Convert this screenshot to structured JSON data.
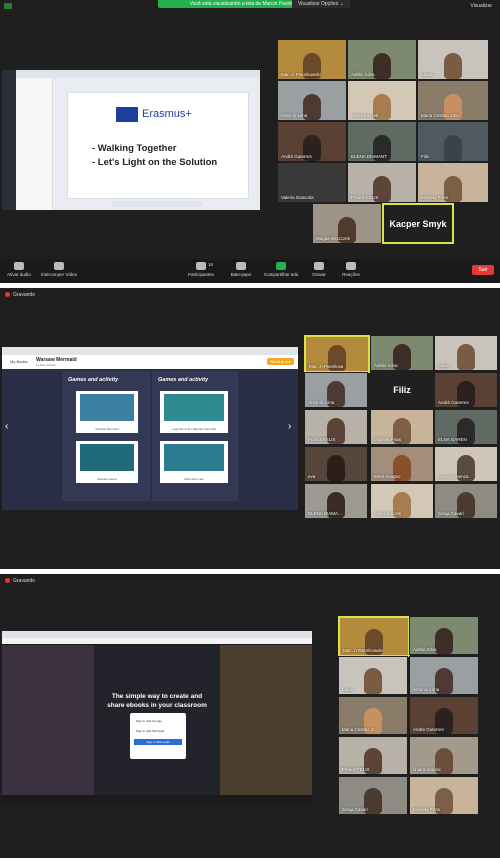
{
  "p1": {
    "banner": "Você está visualizando a tela de Marcin Pasnikowski",
    "view_options": "Visualizar Opções ⌄",
    "top_right": "Visualizar",
    "slide": {
      "brand": "Erasmus+",
      "line1": "- Walking Together",
      "line2": "- Let's Light on the Solution"
    },
    "participants": [
      {
        "name": "Mar...n Pasnikowski"
      },
      {
        "name": "Adélio Silva"
      },
      {
        "name": "Laura"
      },
      {
        "name": "António Lima"
      },
      {
        "name": "emilia baczek"
      },
      {
        "name": "Maria Cristina Zoie"
      },
      {
        "name": "André Guterres"
      },
      {
        "name": "ELENA DIAMANT"
      },
      {
        "name": "Filiz"
      },
      {
        "name": "Valeria Giancola"
      },
      {
        "name": "Franck FELIX"
      },
      {
        "name": "Michela Piras"
      },
      {
        "name": "Magda Wiszczek"
      },
      {
        "name": "Kacper Smyk"
      }
    ],
    "toolbar": {
      "mute": "Ativar áudio",
      "video": "Interromper Vídeo",
      "participants": "Participantes",
      "participants_count": "16",
      "chat": "Bate-papo",
      "share": "Compartilhar tela",
      "record": "Gravar",
      "reactions": "Reações",
      "end": "Sair"
    }
  },
  "p2": {
    "recording": "Gravando",
    "book_title": "Warsaw Mermaid",
    "book_author": "by Ewa Wojcik",
    "my_books": "My Books",
    "read_to_me": "Read to me",
    "page_heading": "Games and activity",
    "cards": [
      {
        "caption": "Warsaw Mermaid"
      },
      {
        "caption": "Legends of the Warsaw Mermaid"
      },
      {
        "caption": "Warsaw waves"
      },
      {
        "caption": "Mermaid's tale"
      }
    ],
    "participants": [
      {
        "name": "Mar...n Pasnikow"
      },
      {
        "name": "Adélio Silva"
      },
      {
        "name": "Laura"
      },
      {
        "name": "António Lima"
      },
      {
        "name": "Filiz"
      },
      {
        "name": "André Guterres"
      },
      {
        "name": "Franck FELIX"
      },
      {
        "name": "Michela Piras"
      },
      {
        "name": "ELNA GAREN"
      },
      {
        "name": "eva"
      },
      {
        "name": "Eleni Anagno"
      },
      {
        "name": "Laura Cusenza"
      },
      {
        "name": "ELENA DIAMA..."
      },
      {
        "name": "emilia baczek"
      },
      {
        "name": "Sonja Cavari"
      }
    ]
  },
  "p3": {
    "recording": "Gravando",
    "hero_line1": "The simple way to create and",
    "hero_line2": "share ebooks in your classroom",
    "signin_google": "Sign in with Google",
    "signin_microsoft": "Sign in with Microsoft",
    "signin_email": "Sign in with email",
    "participants": [
      {
        "name": "Mar...n Pasnikowski"
      },
      {
        "name": "Adélio Silva"
      },
      {
        "name": "Laura"
      },
      {
        "name": "António Lima"
      },
      {
        "name": "Maria Cristina Z..."
      },
      {
        "name": "André Guterres"
      },
      {
        "name": "Franck FELIX"
      },
      {
        "name": "chiara scapini"
      },
      {
        "name": "Sonja Cavari"
      },
      {
        "name": "Michela Piras"
      }
    ]
  }
}
